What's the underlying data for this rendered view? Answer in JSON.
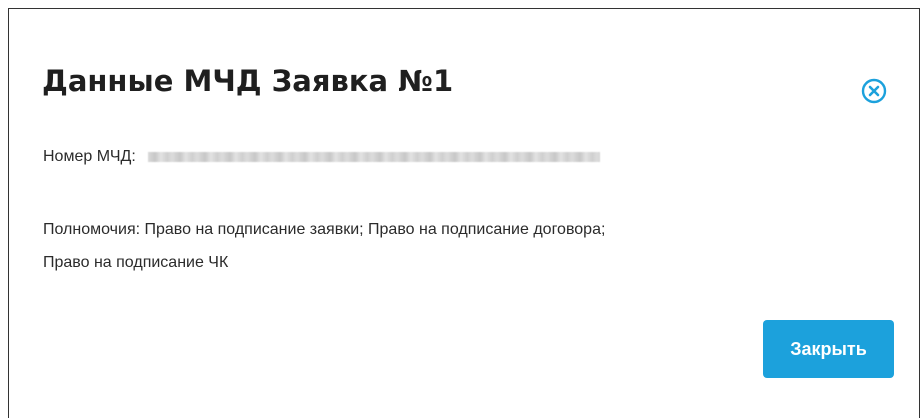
{
  "dialog": {
    "title": "Данные МЧД Заявка №1",
    "close_icon": "close-circle-icon",
    "mcd_number_label": "Номер МЧД:",
    "powers_line1": "Полномочия: Право на подписание заявки; Право на подписание договора;",
    "powers_line2": "Право на подписание ЧК",
    "close_button_label": "Закрыть"
  },
  "colors": {
    "accent": "#1ca1dc",
    "title_text": "#1f1f1f",
    "body_text": "#2b2b2b"
  }
}
